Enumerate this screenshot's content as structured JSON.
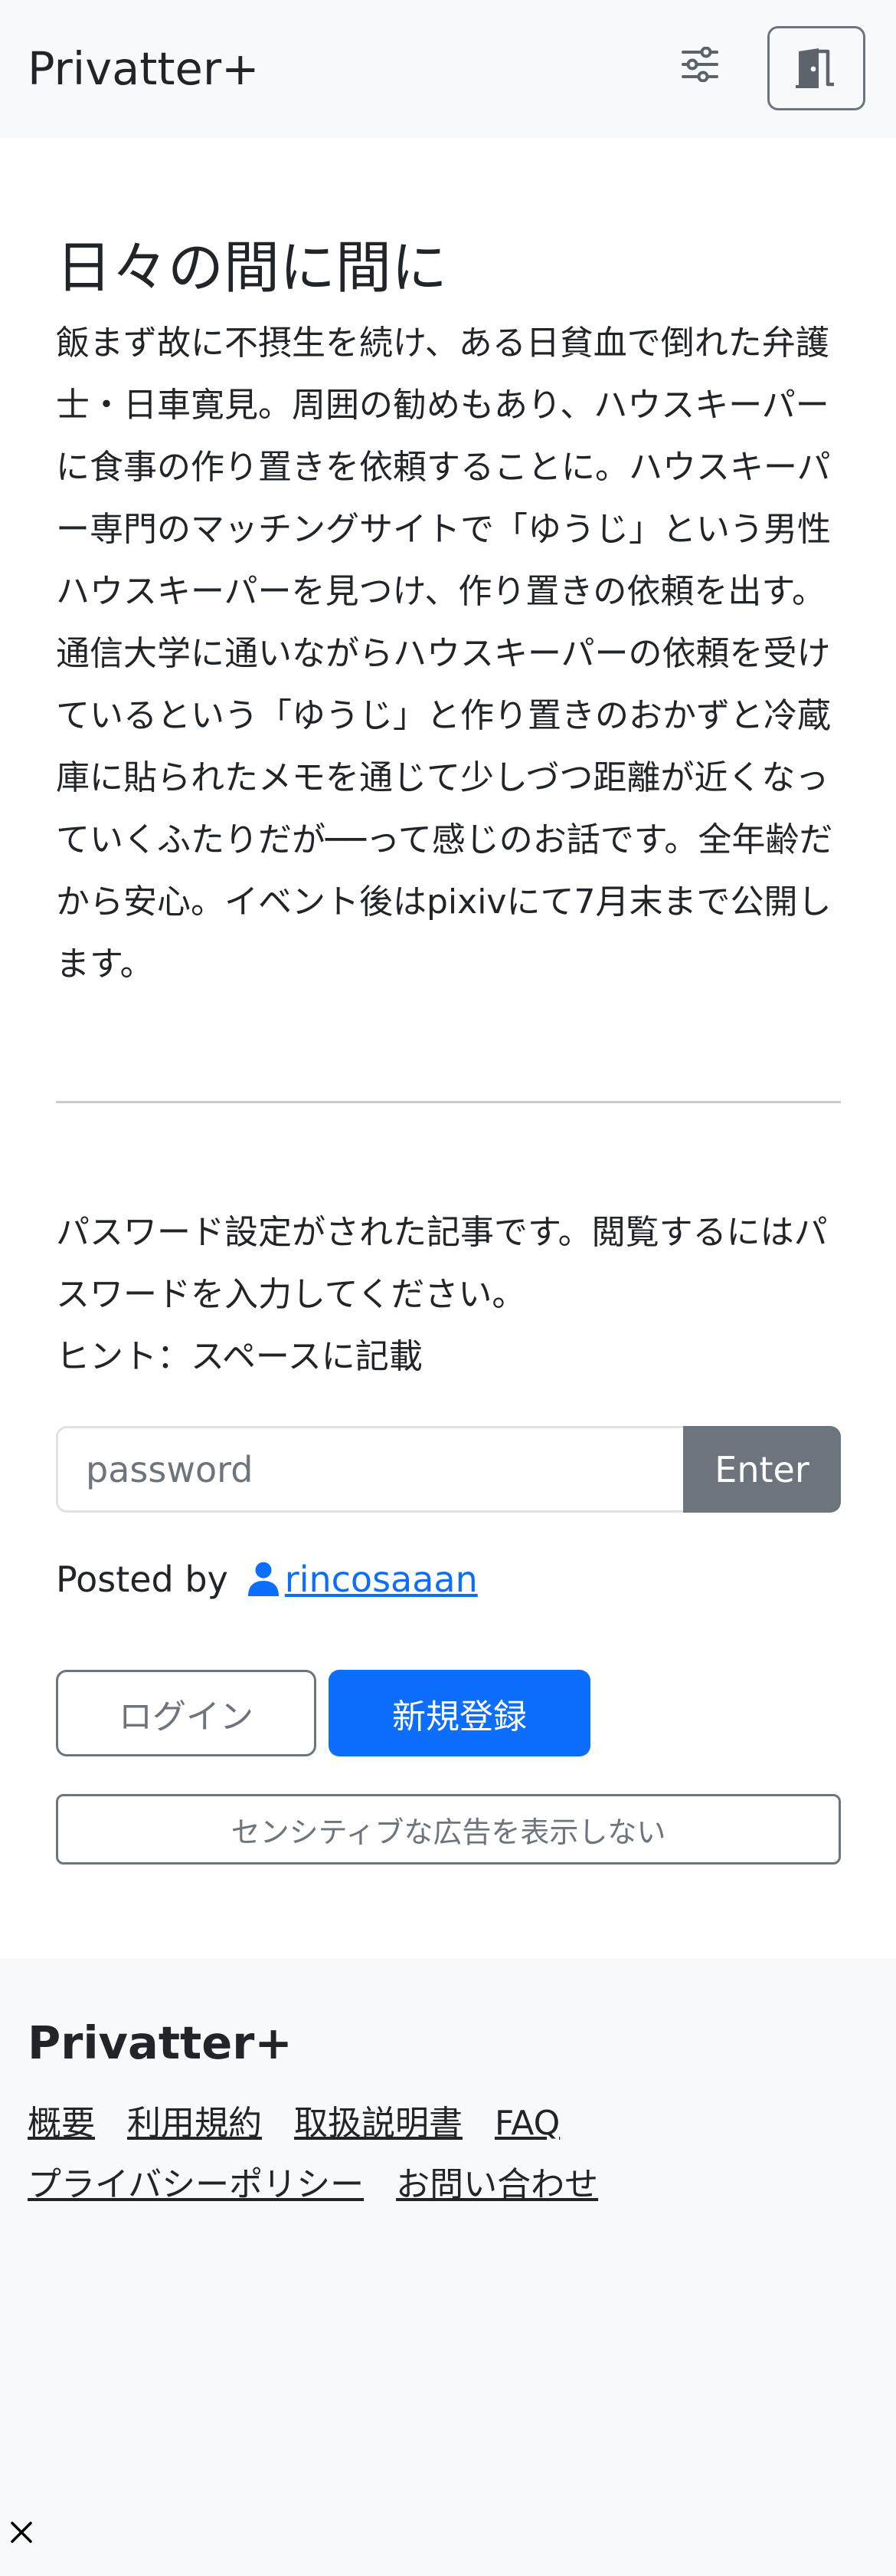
{
  "header": {
    "brand": "Privatter+",
    "settings_icon": "sliders-icon",
    "door_icon": "door-icon"
  },
  "post": {
    "title": "日々の間に間に",
    "description": [
      "飯まず故に不摂生を続け、ある日貧血で倒れた弁護士・日車寛見。周囲の勧めもあり、ハウスキーパーに食事の作り置きを依頼することに。ハウスキーパー専門のマッチングサイトで「ゆうじ」という男性ハウスキーパーを見つけ、作り置きの依頼を出す。",
      "通信大学に通いながらハウスキーパーの依頼を受けているという「ゆうじ」と作り置きのおかずと冷蔵庫に貼られたメモを通じて少しづつ距離が近くなっていくふたりだが──って感じのお話です。全年齢だから安心。イベント後はpixivにて7月末まで公開します。"
    ]
  },
  "password_section": {
    "notice": "パスワード設定がされた記事です。閲覧するにはパスワードを入力してください。",
    "hint": "ヒント：スペースに記載",
    "placeholder": "password",
    "value": "",
    "enter_label": "Enter"
  },
  "author": {
    "posted_by_label": "Posted by",
    "username": "rincosaaan",
    "icon": "person-icon"
  },
  "actions": {
    "login_label": "ログイン",
    "register_label": "新規登録",
    "sensitive_ads_label": "センシティブな広告を表示しない"
  },
  "footer": {
    "brand": "Privatter+",
    "links_row1": [
      "概要",
      "利用規約",
      "取扱説明書",
      "FAQ"
    ],
    "links_row2": [
      "プライバシーポリシー",
      "お問い合わせ"
    ]
  },
  "overlay": {
    "close_icon": "close-icon"
  },
  "colors": {
    "primary": "#0d6efd",
    "secondary": "#6c757d",
    "light_bg": "#f8f9fa",
    "text": "#212529"
  }
}
